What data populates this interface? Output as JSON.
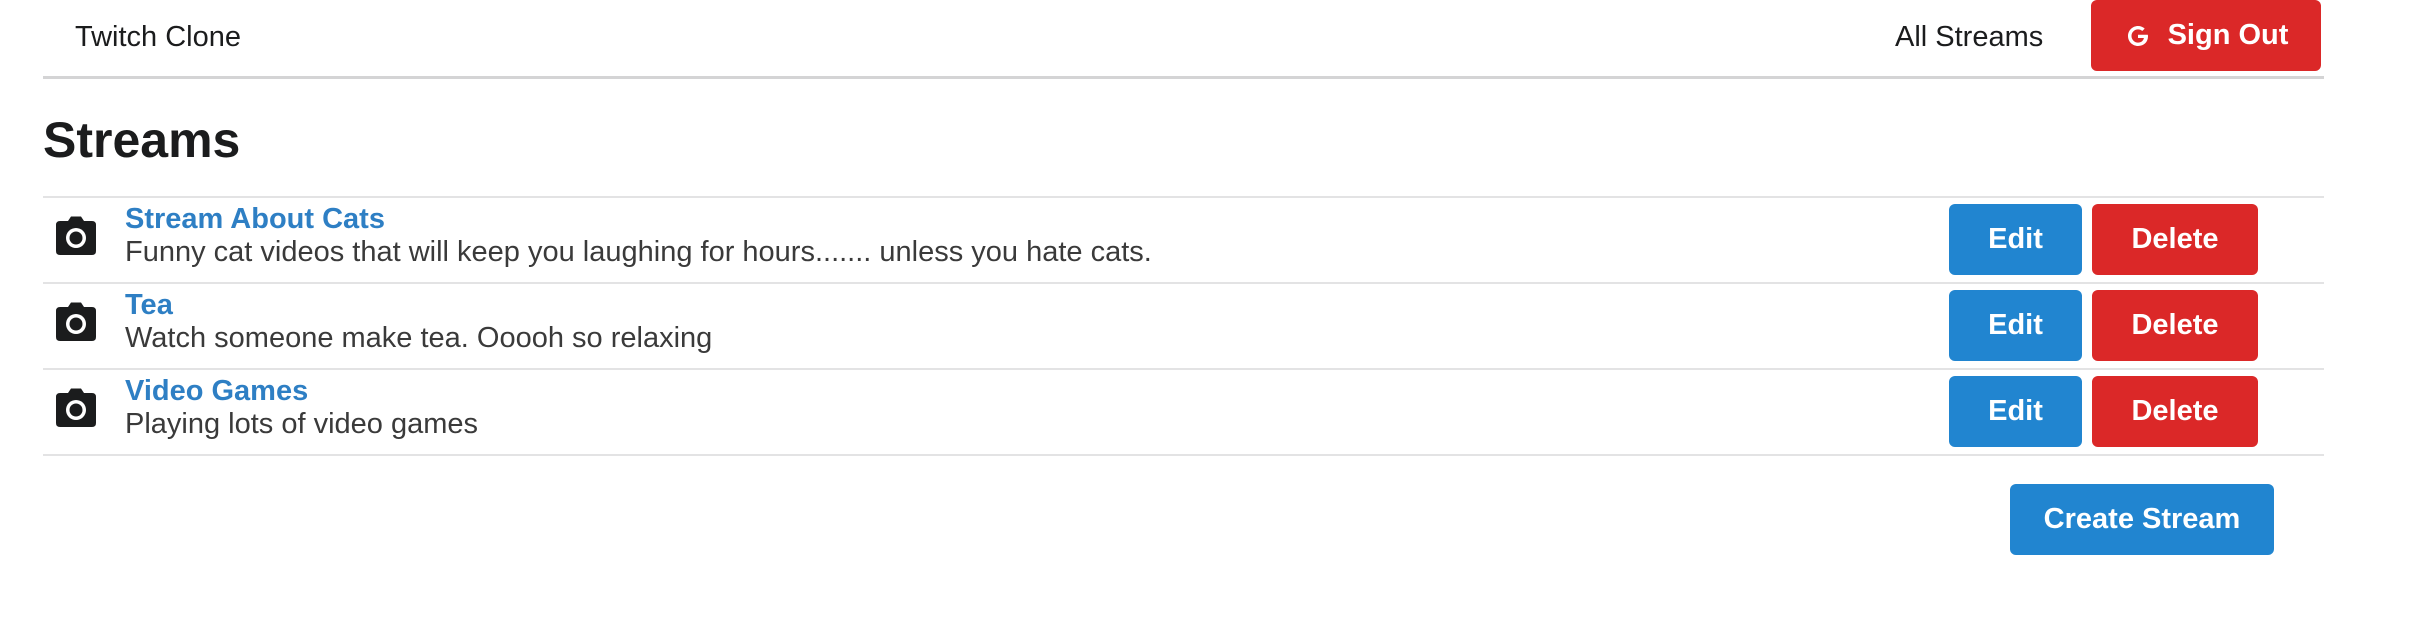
{
  "header": {
    "brand": "Twitch Clone",
    "nav_all_streams": "All Streams",
    "sign_out_label": "Sign Out",
    "sign_out_icon": "google-icon"
  },
  "page": {
    "title": "Streams"
  },
  "streams": [
    {
      "icon": "camera-icon",
      "title": "Stream About Cats",
      "description": "Funny cat videos that will keep you laughing for hours....... unless you hate cats.",
      "edit_label": "Edit",
      "delete_label": "Delete"
    },
    {
      "icon": "camera-icon",
      "title": "Tea",
      "description": "Watch someone make tea. Ooooh so relaxing",
      "edit_label": "Edit",
      "delete_label": "Delete"
    },
    {
      "icon": "camera-icon",
      "title": "Video Games",
      "description": "Playing lots of video games",
      "edit_label": "Edit",
      "delete_label": "Delete"
    }
  ],
  "create_stream_label": "Create Stream",
  "colors": {
    "primary": "#2185d0",
    "danger": "#db2828",
    "link": "#2e7fc4",
    "text": "#1b1c1d",
    "divider": "#e3e3e4"
  }
}
